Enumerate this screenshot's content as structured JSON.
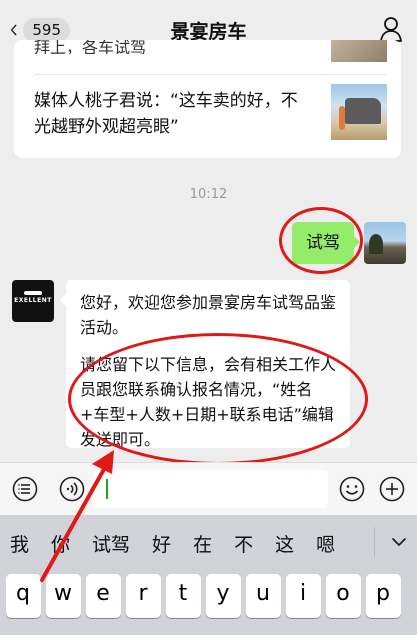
{
  "nav": {
    "title": "景宴房车",
    "unread_count": "595",
    "back_icon": "chevron-left-icon",
    "user_icon": "person-icon"
  },
  "article_card": {
    "prev_title_partial": "拜上，各车试驾",
    "item_title": "媒体人桃子君说：“这车卖的好，不光越野外观超亮眼”"
  },
  "timestamp": "10:12",
  "outgoing": {
    "text": "试驾"
  },
  "incoming": {
    "avatar_logo": "EXELLENT",
    "paragraph1": "您好，欢迎您参加景宴房车试驾品鉴活动。",
    "paragraph2": "请您留下以下信息，会有相关工作人员跟您联系确认报名情况，“姓名+车型+人数+日期+联系电话”编辑发送即可。"
  },
  "input_bar": {
    "value": "",
    "left_icon": "list-icon",
    "voice_icon": "voice-icon",
    "emoji_icon": "emoji-icon",
    "plus_icon": "plus-icon"
  },
  "keyboard": {
    "candidates": [
      "我",
      "你",
      "试驾",
      "好",
      "在",
      "不",
      "这",
      "嗯"
    ],
    "row1": [
      "q",
      "w",
      "e",
      "r",
      "t",
      "y",
      "u",
      "i",
      "o",
      "p"
    ],
    "expand_icon": "chevron-down-icon"
  },
  "annotations": {
    "color": "#e01818"
  }
}
